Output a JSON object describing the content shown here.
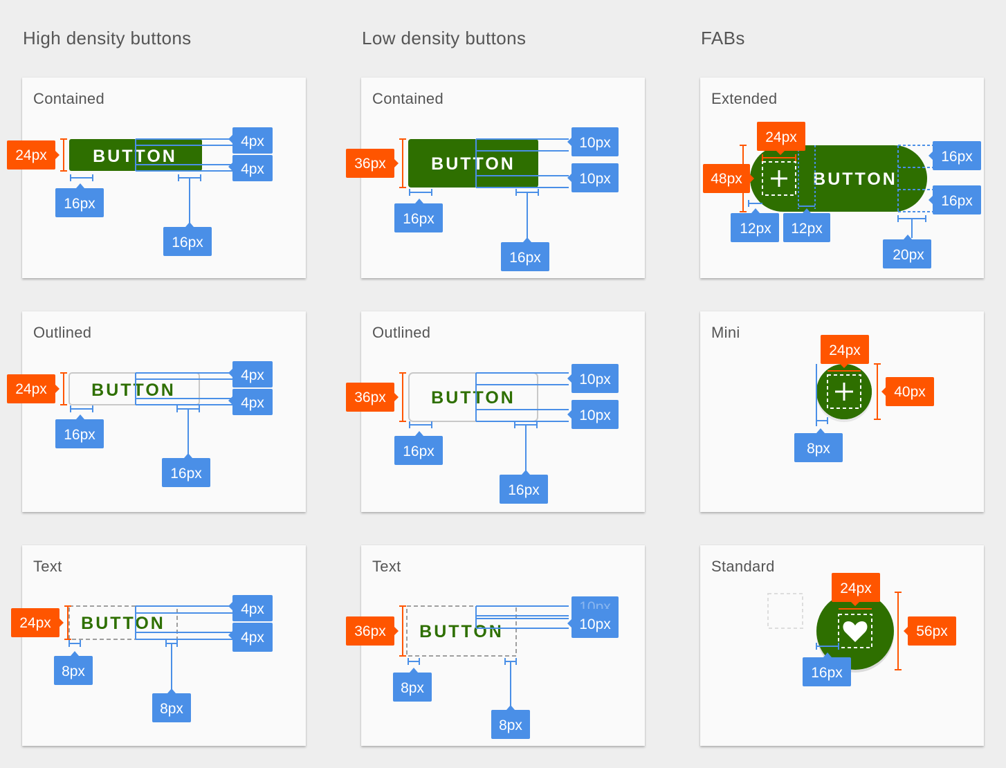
{
  "columns": {
    "high_density": {
      "title": "High density buttons"
    },
    "low_density": {
      "title": "Low density buttons"
    },
    "fabs": {
      "title": "FABs"
    }
  },
  "colors": {
    "primary_button": "#2e6f00",
    "measure_blue": "#4a8fe7",
    "measure_orange": "#ff5500",
    "card_bg": "#fafafa",
    "page_bg": "#eeeeee"
  },
  "cards": {
    "hd_contained": {
      "label": "Contained",
      "button_label": "BUTTON",
      "height_tag": "24px",
      "top_pad_tag": "4px",
      "bottom_pad_tag": "4px",
      "left_pad_tag": "16px",
      "right_pad_tag": "16px"
    },
    "hd_outlined": {
      "label": "Outlined",
      "button_label": "BUTTON",
      "height_tag": "24px",
      "top_pad_tag": "4px",
      "bottom_pad_tag": "4px",
      "left_pad_tag": "16px",
      "right_pad_tag": "16px"
    },
    "hd_text": {
      "label": "Text",
      "button_label": "BUTTON",
      "height_tag": "24px",
      "top_pad_tag": "4px",
      "bottom_pad_tag": "4px",
      "left_pad_tag": "8px",
      "right_pad_tag": "8px"
    },
    "ld_contained": {
      "label": "Contained",
      "button_label": "BUTTON",
      "height_tag": "36px",
      "top_pad_tag": "10px",
      "bottom_pad_tag": "10px",
      "left_pad_tag": "16px",
      "right_pad_tag": "16px"
    },
    "ld_outlined": {
      "label": "Outlined",
      "button_label": "BUTTON",
      "height_tag": "36px",
      "top_pad_tag": "10px",
      "bottom_pad_tag": "10px",
      "left_pad_tag": "16px",
      "right_pad_tag": "16px"
    },
    "ld_text": {
      "label": "Text",
      "button_label": "BUTTON",
      "height_tag": "36px",
      "top_pad_tag": "10px",
      "bottom_pad_tag": "10px",
      "left_pad_tag": "8px",
      "right_pad_tag": "8px"
    },
    "fab_extended": {
      "label": "Extended",
      "button_label": "BUTTON",
      "icon_tag": "24px",
      "height_tag": "48px",
      "top_pad_tag": "16px",
      "bottom_pad_tag": "16px",
      "left_pad_tag": "12px",
      "icon_gap_tag": "12px",
      "right_pad_tag": "20px"
    },
    "fab_mini": {
      "label": "Mini",
      "icon_tag": "24px",
      "height_tag": "40px",
      "pad_tag": "8px"
    },
    "fab_standard": {
      "label": "Standard",
      "icon_tag": "24px",
      "height_tag": "56px",
      "pad_tag": "16px"
    }
  }
}
